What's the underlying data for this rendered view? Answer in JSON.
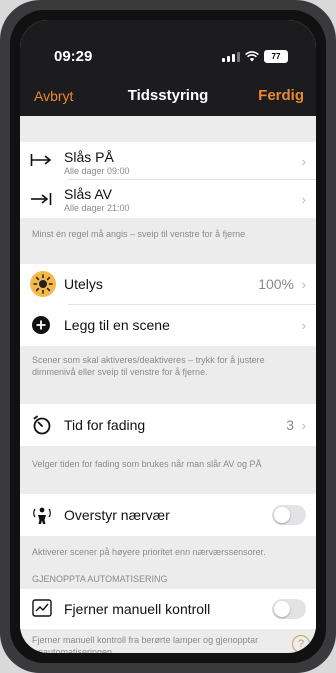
{
  "status_bar": {
    "time": "09:29",
    "battery": "77"
  },
  "nav": {
    "cancel": "Avbryt",
    "title": "Tidsstyring",
    "done": "Ferdig"
  },
  "schedule": {
    "on_label": "Slås PÅ",
    "on_sub": "Alle dager  09:00",
    "off_label": "Slås AV",
    "off_sub": "Alle dager  21:00",
    "note": "Minst én regel må angis – sveip til venstre for å fjerne"
  },
  "scenes": {
    "items": [
      {
        "label": "Utelys",
        "value": "100%"
      }
    ],
    "add_label": "Legg til en scene",
    "note": "Scener som skal aktiveres/deaktiveres – trykk for å justere dimmenivå eller sveip til venstre for å fjerne."
  },
  "fading": {
    "label": "Tid for fading",
    "value": "3",
    "note": "Velger tiden for fading som brukes når man slår AV og PÅ"
  },
  "presence": {
    "label": "Overstyr nærvær",
    "note": "Aktiverer scener på høyere prioritet enn nærværssensorer."
  },
  "resume": {
    "header": "GJENOPPTA AUTOMATISERING",
    "label": "Fjerner manuell kontroll",
    "note": "Fjerner manuell kontroll fra berørte lamper og gjenopptar lysautomatiseringen."
  },
  "help_icon": "?",
  "colors": {
    "accent": "#e8892f",
    "scene_icon_bg": "#f5b94a"
  }
}
